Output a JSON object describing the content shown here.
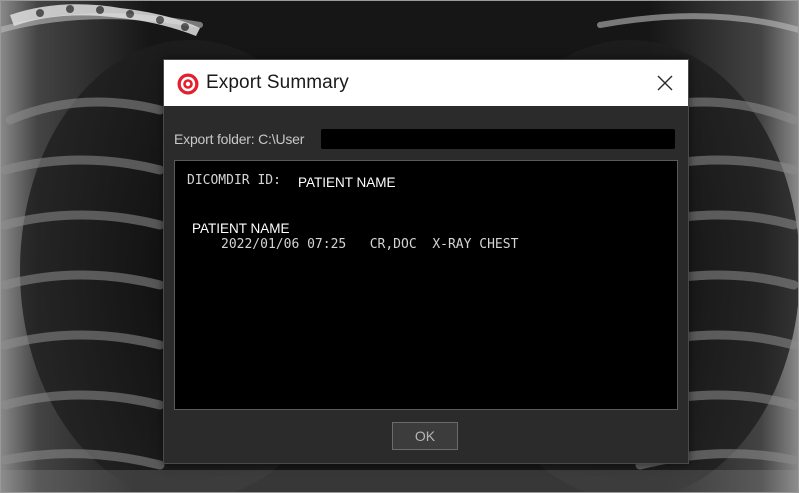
{
  "dialog": {
    "title": "Export Summary",
    "app_icon": "app-logo-icon",
    "close_icon": "close-icon"
  },
  "export": {
    "folder_label": "Export folder: C:\\User"
  },
  "summary": {
    "dicomdir_label": "DICOMDIR ID:",
    "dicomdir_value": "PATIENT NAME",
    "patient_name": "PATIENT NAME",
    "study_line": "2022/01/06 07:25   CR,DOC  X-RAY CHEST"
  },
  "buttons": {
    "ok_label": "OK"
  },
  "colors": {
    "accent": "#e5202e",
    "dialog_bg": "#2b2b2b",
    "summary_bg": "#000000"
  }
}
